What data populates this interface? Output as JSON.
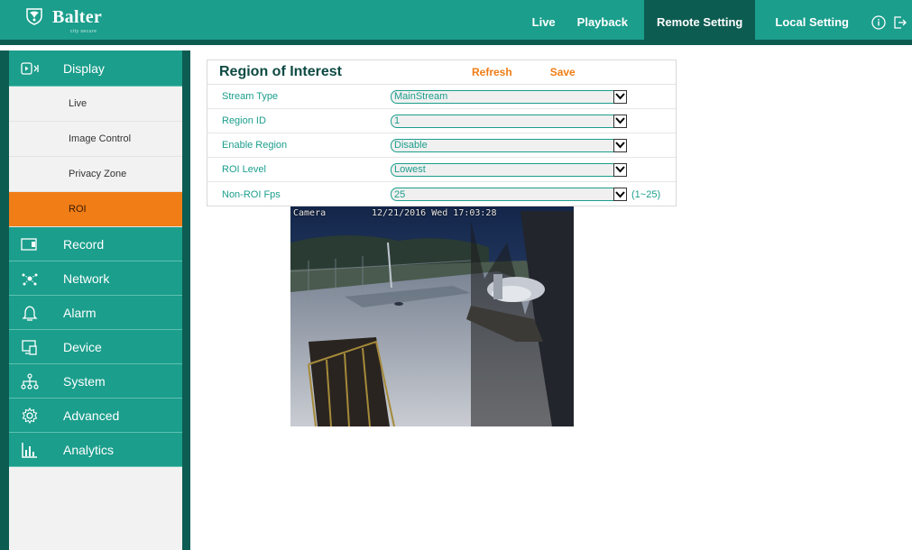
{
  "header": {
    "brand": "Balter",
    "tagline": "city secure",
    "nav": [
      "Live",
      "Playback",
      "Remote Setting",
      "Local Setting"
    ],
    "active_nav": "Remote Setting",
    "colors": {
      "primary": "#1b9e8c",
      "dark": "#0d5c52",
      "accent": "#f07d16"
    }
  },
  "sidebar": {
    "display": {
      "label": "Display",
      "icon": "display-icon"
    },
    "sub_items": [
      "Live",
      "Image Control",
      "Privacy Zone",
      "ROI"
    ],
    "active_sub": "ROI",
    "sections": [
      {
        "label": "Record",
        "icon": "record-icon"
      },
      {
        "label": "Network",
        "icon": "network-icon"
      },
      {
        "label": "Alarm",
        "icon": "bell-icon"
      },
      {
        "label": "Device",
        "icon": "device-icon"
      },
      {
        "label": "System",
        "icon": "system-tree-icon"
      },
      {
        "label": "Advanced",
        "icon": "gear-icon"
      },
      {
        "label": "Analytics",
        "icon": "bar-chart-icon"
      }
    ]
  },
  "panel": {
    "title": "Region of Interest",
    "refresh_label": "Refresh",
    "save_label": "Save",
    "rows": [
      {
        "label": "Stream Type",
        "value": "MainStream"
      },
      {
        "label": "Region ID",
        "value": "1"
      },
      {
        "label": "Enable Region",
        "value": "Disable"
      },
      {
        "label": "ROI Level",
        "value": "Lowest"
      },
      {
        "label": "Non-ROI Fps",
        "value": "25",
        "hint": "(1~25)"
      }
    ]
  },
  "camera": {
    "name": "Camera",
    "timestamp": "12/21/2016 Wed 17:03:28"
  }
}
